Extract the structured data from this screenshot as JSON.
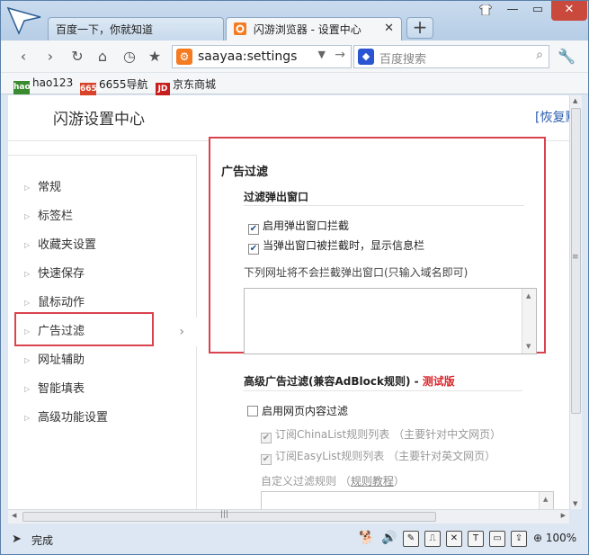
{
  "tabs": [
    {
      "label": "百度一下，你就知道",
      "active": false
    },
    {
      "label": "闪游浏览器 - 设置中心",
      "active": true
    }
  ],
  "nav": {
    "address": "saayaa:settings",
    "search_placeholder": "百度搜索"
  },
  "bookmarks": [
    {
      "label": "hao123",
      "icon": "hao123-icon"
    },
    {
      "label": "6655导航",
      "icon": "6655-icon"
    },
    {
      "label": "京东商城",
      "icon": "jd-icon"
    }
  ],
  "page": {
    "title": "闪游设置中心",
    "restore_link": "[恢复默认设置]"
  },
  "sidebar": {
    "items": [
      {
        "label": "常规"
      },
      {
        "label": "标签栏"
      },
      {
        "label": "收藏夹设置"
      },
      {
        "label": "快速保存"
      },
      {
        "label": "鼠标动作"
      },
      {
        "label": "广告过滤"
      },
      {
        "label": "网址辅助"
      },
      {
        "label": "智能填表"
      },
      {
        "label": "高级功能设置"
      }
    ],
    "selected": "广告过滤"
  },
  "adfilter": {
    "section_title": "广告过滤",
    "popup_title": "过滤弹出窗口",
    "enable_popup_block": "启用弹出窗口拦截",
    "show_info_bar": "当弹出窗口被拦截时，显示信息栏",
    "whitelist_note": "下列网址将不会拦截弹出窗口(只输入域名即可)",
    "whitelist_value": ""
  },
  "advanced": {
    "title": "高级广告过滤(兼容AdBlock规则)",
    "separator": " - ",
    "beta": "测试版",
    "enable_content_filter": "启用网页内容过滤",
    "chinalist": "订阅ChinaList规则列表 （主要针对中文网页）",
    "easylist": "订阅EasyList规则列表 （主要针对英文网页）",
    "custom_rules_label": "自定义过滤规则 （",
    "rules_tutorial": "规则教程",
    "custom_rules_close": "）"
  },
  "status": {
    "text": "完成",
    "zoom": "100%"
  },
  "colors": {
    "highlight_border": "#d9434e",
    "beta": "#d9262b",
    "link": "#2a5db0"
  }
}
